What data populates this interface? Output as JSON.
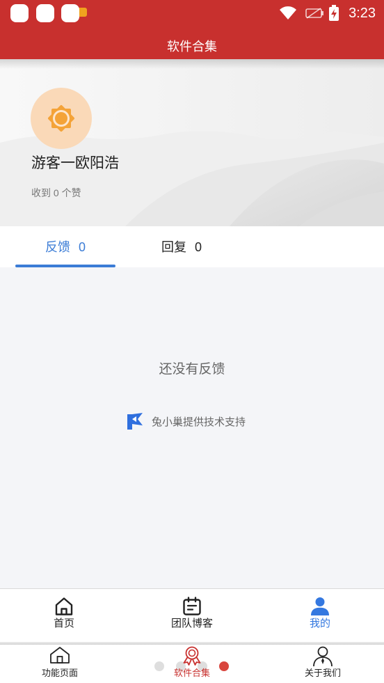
{
  "status_bar": {
    "time": "3:23",
    "icons": [
      "notification-icon",
      "wifi-icon",
      "sim-off-icon",
      "battery-charging-icon"
    ]
  },
  "header": {
    "title": "软件合集"
  },
  "profile": {
    "avatar_icon": "sun-icon",
    "name": "游客一欧阳浩",
    "likes_text": "收到 0 个赞"
  },
  "tabs": [
    {
      "label": "反馈",
      "count": 0,
      "active": true
    },
    {
      "label": "回复",
      "count": 0,
      "active": false
    }
  ],
  "empty_state": {
    "message": "还没有反馈"
  },
  "support": {
    "icon": "tuxiaochao-logo-icon",
    "text": "兔小巢提供技术支持"
  },
  "web_nav": [
    {
      "label": "首页",
      "icon": "home-icon",
      "active": false
    },
    {
      "label": "团队博客",
      "icon": "calendar-icon",
      "active": false
    },
    {
      "label": "我的",
      "icon": "user-icon",
      "active": true
    }
  ],
  "pager": {
    "dots": [
      {
        "active": false
      },
      {
        "active": false
      },
      {
        "active": false
      },
      {
        "active": true
      }
    ]
  },
  "app_nav": [
    {
      "label": "功能页面",
      "icon": "home-outline-icon",
      "active": false
    },
    {
      "label": "软件合集",
      "icon": "award-icon",
      "active": true
    },
    {
      "label": "关于我们",
      "icon": "person-icon",
      "active": false
    }
  ],
  "colors": {
    "brand_red": "#c8302e",
    "tab_active_blue": "#3b7cd6",
    "nav_active_blue": "#3478e0",
    "avatar_bg": "#fad9b8",
    "sun_orange": "#f4a338",
    "page_bg": "#f4f5f8",
    "pager_active": "#d9463e",
    "support_logo_blue": "#2f6fde"
  }
}
